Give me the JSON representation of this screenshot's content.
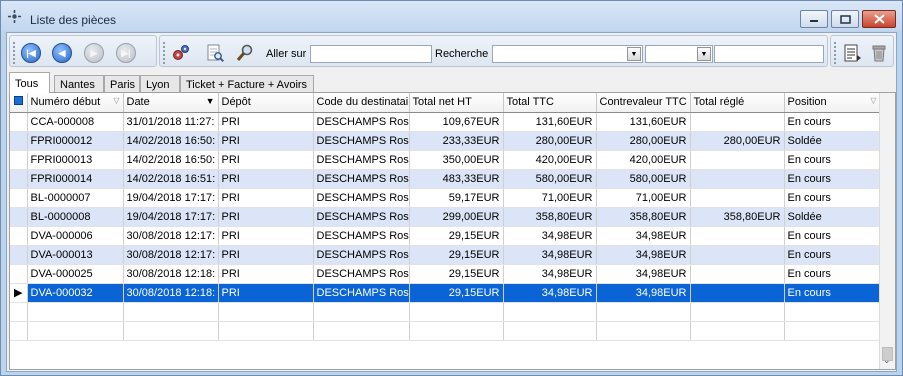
{
  "window": {
    "title": "Liste des pièces"
  },
  "toolbar": {
    "goto_label": "Aller sur :",
    "goto_value": "",
    "search_label": "Recherche :",
    "search_combo1": "",
    "search_combo2": "",
    "search_value": ""
  },
  "tabs": [
    "Tous",
    "Nantes",
    "Paris",
    "Lyon",
    "Ticket + Facture + Avoirs"
  ],
  "table": {
    "columns": [
      "Numéro début",
      "Date",
      "Dépôt",
      "Code du destinataire",
      "Total net HT",
      "Total TTC",
      "Contrevaleur TTC",
      "Total réglé",
      "Position"
    ],
    "rows": [
      [
        "CCA-000008",
        "31/01/2018 11:27:",
        "PRI",
        "DESCHAMPS Rose",
        "109,67EUR",
        "131,60EUR",
        "131,60EUR",
        "",
        "En cours"
      ],
      [
        "FPRI000012",
        "14/02/2018 16:50:",
        "PRI",
        "DESCHAMPS Rose",
        "233,33EUR",
        "280,00EUR",
        "280,00EUR",
        "280,00EUR",
        "Soldée"
      ],
      [
        "FPRI000013",
        "14/02/2018 16:50:",
        "PRI",
        "DESCHAMPS Rose",
        "350,00EUR",
        "420,00EUR",
        "420,00EUR",
        "",
        "En cours"
      ],
      [
        "FPRI000014",
        "14/02/2018 16:51:",
        "PRI",
        "DESCHAMPS Rose",
        "483,33EUR",
        "580,00EUR",
        "580,00EUR",
        "",
        "En cours"
      ],
      [
        "BL-0000007",
        "19/04/2018 17:17:",
        "PRI",
        "DESCHAMPS Rose",
        "59,17EUR",
        "71,00EUR",
        "71,00EUR",
        "",
        "En cours"
      ],
      [
        "BL-0000008",
        "19/04/2018 17:17:",
        "PRI",
        "DESCHAMPS Rose",
        "299,00EUR",
        "358,80EUR",
        "358,80EUR",
        "358,80EUR",
        "Soldée"
      ],
      [
        "DVA-000006",
        "30/08/2018 12:17:",
        "PRI",
        "DESCHAMPS Rose",
        "29,15EUR",
        "34,98EUR",
        "34,98EUR",
        "",
        "En cours"
      ],
      [
        "DVA-000013",
        "30/08/2018 12:17:",
        "PRI",
        "DESCHAMPS Rose",
        "29,15EUR",
        "34,98EUR",
        "34,98EUR",
        "",
        "En cours"
      ],
      [
        "DVA-000025",
        "30/08/2018 12:18:",
        "PRI",
        "DESCHAMPS Rose",
        "29,15EUR",
        "34,98EUR",
        "34,98EUR",
        "",
        "En cours"
      ],
      [
        "DVA-000032",
        "30/08/2018 12:18:",
        "PRI",
        "DESCHAMPS Rose",
        "29,15EUR",
        "34,98EUR",
        "34,98EUR",
        "",
        "En cours"
      ]
    ],
    "selected_row": 9
  },
  "colors": {
    "selection": "#0a64d6",
    "alt_row": "#dbe5f7",
    "frame": "#bcd3ec"
  },
  "icons": [
    "first-record-icon",
    "previous-record-icon",
    "next-record-icon",
    "last-record-icon",
    "gears-icon",
    "document-search-icon",
    "magnifier-icon",
    "report-icon",
    "trash-icon"
  ]
}
